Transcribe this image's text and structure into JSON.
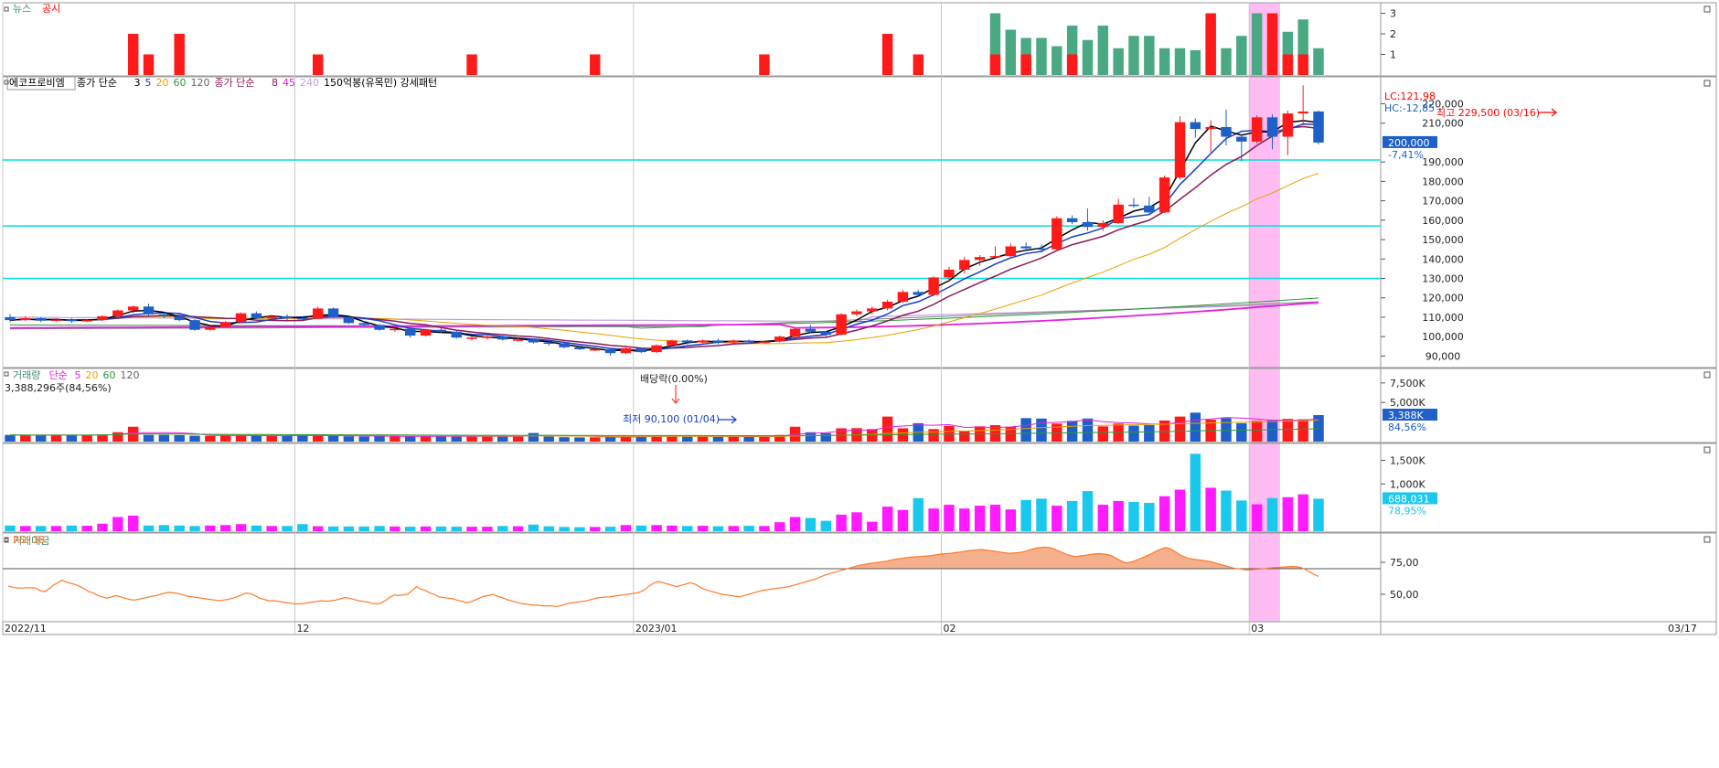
{
  "panels": {
    "news": {
      "labels": [
        "뉴스",
        "공시"
      ],
      "label_colors": [
        "#3a8f6a",
        "#ff0000"
      ],
      "ticks": [
        "3",
        "2",
        "1"
      ]
    },
    "price": {
      "legend": [
        {
          "text": "에코프로비엠",
          "color": "#000000"
        },
        {
          "text": "종가 단순",
          "color": "#000000"
        },
        {
          "text": "3",
          "color": "#000000"
        },
        {
          "text": "5",
          "color": "#1a3fc4"
        },
        {
          "text": "20",
          "color": "#e8a000"
        },
        {
          "text": "60",
          "color": "#2a9a3a"
        },
        {
          "text": "120",
          "color": "#666666"
        },
        {
          "text": "종가 단순",
          "color": "#8b1a5a"
        },
        {
          "text": "8",
          "color": "#8b1a5a"
        },
        {
          "text": "45",
          "color": "#e020e0"
        },
        {
          "text": "240",
          "color": "#c0a0e0"
        },
        {
          "text": "150억봉(유목민) 강세패턴",
          "color": "#000000"
        }
      ],
      "ticks": [
        "220,000",
        "210,000",
        "190,000",
        "180,000",
        "170,000",
        "160,000",
        "150,000",
        "140,000",
        "130,000",
        "120,000",
        "110,000",
        "100,000",
        "90,000"
      ],
      "lc": "LC:121,98",
      "hc": "HC:-12,85",
      "current": "200,000",
      "current_pct": "-7,41%",
      "annotations": {
        "high": "최고 229,500 (03/16)",
        "low": "최저 90,100 (01/04)",
        "dividend": "배당락(0.00%)"
      }
    },
    "volume": {
      "legend": [
        {
          "text": "거래량",
          "color": "#3a8f6a"
        },
        {
          "text": "단순",
          "color": "#e020e0"
        },
        {
          "text": "5",
          "color": "#e020e0"
        },
        {
          "text": "20",
          "color": "#e8a000"
        },
        {
          "text": "60",
          "color": "#2a9a3a"
        },
        {
          "text": "120",
          "color": "#666666"
        }
      ],
      "info": "3,388,296주(84,56%)",
      "ticks": [
        "7,500K",
        "5,000K"
      ],
      "current": "3,388K",
      "current_pct": "84,56%"
    },
    "amount": {
      "legend": "거래대금",
      "ticks": [
        "1,500K",
        "1,000K"
      ],
      "current": "688,031",
      "current_pct": "78,95%"
    },
    "rsi": {
      "legend": "RSI 18",
      "ticks": [
        "75,00",
        "50,00"
      ]
    }
  },
  "xaxis": {
    "labels": [
      "2022/11",
      "12",
      "2023/01",
      "02",
      "03"
    ],
    "right_label": "03/17"
  },
  "colors": {
    "up": "#ff1a1a",
    "down": "#1e5fc8",
    "news": "#4aa882",
    "amount_up": "#ff1aff",
    "amount_down": "#1ac8ee",
    "rsi": "#ff7a2a",
    "rsi_fill": "#f4a882",
    "highlight": "#ffb0f0",
    "hline": "#00e0e0"
  },
  "chart_data": {
    "type": "candlestick",
    "title": "에코프로비엠",
    "ylim": [
      85000,
      232000
    ],
    "hlines": [
      191000,
      157000,
      130000
    ],
    "candles": [
      [
        110000,
        111500,
        107500,
        108500
      ],
      [
        108500,
        110500,
        108000,
        109500
      ],
      [
        109500,
        110000,
        107500,
        108200
      ],
      [
        108200,
        109500,
        107800,
        108800
      ],
      [
        108800,
        109500,
        107000,
        108000
      ],
      [
        108000,
        109000,
        107500,
        108500
      ],
      [
        108500,
        111000,
        108000,
        110500
      ],
      [
        110500,
        114000,
        110000,
        113500
      ],
      [
        113500,
        116000,
        112000,
        115500
      ],
      [
        115500,
        117000,
        111000,
        111500
      ],
      [
        111500,
        112500,
        109500,
        110500
      ],
      [
        110500,
        111500,
        108000,
        108500
      ],
      [
        108500,
        109000,
        103000,
        103500
      ],
      [
        103500,
        105500,
        103000,
        105000
      ],
      [
        105000,
        108000,
        104500,
        107500
      ],
      [
        107500,
        112500,
        107000,
        112000
      ],
      [
        112000,
        113000,
        109000,
        109500
      ],
      [
        109500,
        111000,
        109000,
        110500
      ],
      [
        110500,
        111500,
        108500,
        109500
      ],
      [
        109500,
        110500,
        108500,
        109200
      ],
      [
        109200,
        115500,
        109000,
        114500
      ],
      [
        114500,
        115000,
        109500,
        110000
      ],
      [
        110000,
        111000,
        106500,
        107000
      ],
      [
        107000,
        108000,
        105500,
        106000
      ],
      [
        106000,
        106500,
        103000,
        103500
      ],
      [
        103500,
        104500,
        102500,
        104000
      ],
      [
        104000,
        104500,
        99500,
        100500
      ],
      [
        100500,
        104000,
        100000,
        103500
      ],
      [
        103500,
        104500,
        102000,
        102500
      ],
      [
        102500,
        103000,
        99000,
        99500
      ],
      [
        99500,
        100000,
        98000,
        99500
      ],
      [
        99500,
        100500,
        98500,
        100000
      ],
      [
        100000,
        100500,
        98000,
        98500
      ],
      [
        98500,
        99500,
        97500,
        98500
      ],
      [
        98500,
        99000,
        96500,
        97000
      ],
      [
        97000,
        98000,
        95500,
        96500
      ],
      [
        96500,
        97500,
        94000,
        94500
      ],
      [
        94500,
        95000,
        93000,
        93500
      ],
      [
        93500,
        94500,
        92500,
        93500
      ],
      [
        93500,
        94000,
        90100,
        91500
      ],
      [
        91500,
        94500,
        91000,
        94000
      ],
      [
        94000,
        94500,
        91500,
        92000
      ],
      [
        92000,
        96000,
        91500,
        95500
      ],
      [
        95500,
        98500,
        95000,
        98000
      ],
      [
        98000,
        98500,
        96000,
        97000
      ],
      [
        97000,
        98500,
        96500,
        98000
      ],
      [
        98000,
        99000,
        96000,
        97000
      ],
      [
        97000,
        98500,
        96500,
        98000
      ],
      [
        98000,
        98500,
        96500,
        97000
      ],
      [
        97000,
        98000,
        96500,
        97500
      ],
      [
        97500,
        100500,
        97000,
        100000
      ],
      [
        100000,
        104500,
        99500,
        104000
      ],
      [
        104000,
        106000,
        102000,
        102500
      ],
      [
        102500,
        103000,
        100000,
        101000
      ],
      [
        101000,
        112000,
        100500,
        111500
      ],
      [
        111500,
        114000,
        110500,
        113000
      ],
      [
        113000,
        115500,
        111500,
        114500
      ],
      [
        114500,
        119000,
        113500,
        118000
      ],
      [
        118000,
        124000,
        117500,
        123000
      ],
      [
        123000,
        124000,
        120500,
        121500
      ],
      [
        121500,
        131000,
        121000,
        130500
      ],
      [
        130500,
        136000,
        128500,
        134500
      ],
      [
        134500,
        141000,
        132500,
        139500
      ],
      [
        139500,
        142000,
        136500,
        141000
      ],
      [
        141000,
        146500,
        140500,
        141500
      ],
      [
        141500,
        148000,
        140500,
        146500
      ],
      [
        146500,
        148500,
        144000,
        145500
      ],
      [
        145500,
        147500,
        144000,
        145000
      ],
      [
        145000,
        162000,
        144500,
        161000
      ],
      [
        161000,
        162500,
        158000,
        159000
      ],
      [
        159000,
        166000,
        154500,
        156500
      ],
      [
        156500,
        160000,
        154500,
        158500
      ],
      [
        158500,
        171000,
        158000,
        168000
      ],
      [
        168000,
        171500,
        166500,
        167500
      ],
      [
        167500,
        172000,
        163000,
        164000
      ],
      [
        164000,
        183000,
        163500,
        182000
      ],
      [
        182000,
        213500,
        181000,
        210500
      ],
      [
        210500,
        212500,
        202500,
        207000
      ],
      [
        207000,
        211500,
        195000,
        208000
      ],
      [
        208000,
        217000,
        198500,
        203000
      ],
      [
        203000,
        204500,
        190500,
        200500
      ],
      [
        200500,
        214000,
        199500,
        213000
      ],
      [
        213000,
        214500,
        196500,
        203000
      ],
      [
        203000,
        216500,
        193500,
        215000
      ],
      [
        215000,
        229500,
        209000,
        216000
      ],
      [
        216000,
        216500,
        199000,
        200000
      ]
    ],
    "volume_k": [
      850,
      820,
      820,
      820,
      830,
      830,
      900,
      1200,
      1900,
      850,
      850,
      820,
      750,
      720,
      750,
      820,
      750,
      720,
      720,
      900,
      720,
      720,
      680,
      650,
      720,
      680,
      650,
      700,
      680,
      650,
      650,
      680,
      700,
      640,
      1100,
      640,
      560,
      540,
      550,
      560,
      720,
      700,
      720,
      720,
      620,
      650,
      610,
      640,
      660,
      650,
      850,
      1900,
      1200,
      1080,
      1700,
      1720,
      1600,
      3200,
      1700,
      2350,
      1600,
      2000,
      1400,
      1950,
      2100,
      1900,
      3000,
      2950,
      2300,
      2650,
      2950,
      1950,
      2300,
      2050,
      2100,
      2700,
      3200,
      3700,
      2800,
      3000,
      2350,
      2650,
      2800,
      2900,
      2850,
      3388
    ],
    "amount_k": [
      120,
      110,
      110,
      110,
      120,
      115,
      160,
      300,
      330,
      120,
      130,
      120,
      110,
      120,
      130,
      150,
      120,
      110,
      110,
      150,
      105,
      100,
      100,
      100,
      110,
      100,
      95,
      100,
      100,
      95,
      95,
      95,
      110,
      105,
      140,
      105,
      90,
      85,
      90,
      95,
      130,
      120,
      130,
      120,
      110,
      115,
      105,
      110,
      115,
      110,
      190,
      300,
      280,
      220,
      350,
      400,
      200,
      520,
      450,
      700,
      480,
      560,
      480,
      540,
      560,
      460,
      660,
      690,
      540,
      640,
      850,
      560,
      640,
      620,
      600,
      740,
      880,
      1640,
      920,
      860,
      650,
      570,
      700,
      720,
      780,
      688
    ],
    "rsi": [
      56.5,
      55.5,
      55,
      54.8,
      55.2,
      55,
      55,
      53,
      52,
      54,
      57,
      59,
      61,
      59.5,
      58.5,
      57.5,
      56,
      54,
      52,
      51,
      49,
      48,
      47,
      48,
      49,
      48,
      47,
      46,
      45.5,
      46,
      47,
      47.5,
      48.5,
      49,
      50,
      51,
      51.5,
      51,
      50.5,
      49.5,
      48.5,
      48,
      47.5,
      47,
      46.5,
      46,
      45.5,
      45,
      45.5,
      46,
      47,
      48,
      49.5,
      51,
      50.5,
      49,
      47,
      46,
      45,
      45,
      44.5,
      44,
      43.5,
      43,
      42.5,
      42.5,
      42.8,
      43.5,
      44,
      44.5,
      45,
      44.5,
      45,
      45.5,
      46.5,
      47.5,
      47,
      46,
      45,
      44.5,
      44,
      43,
      42.5,
      43,
      45,
      47.5,
      49.5,
      49,
      49.5,
      50,
      53,
      56,
      54,
      53,
      51,
      50,
      48,
      47.5,
      47,
      46.5,
      45.5,
      44.5,
      43.5,
      44,
      45.5,
      47,
      48.5,
      49,
      50,
      48.5,
      47.5,
      46,
      45,
      44,
      43,
      42.5,
      42,
      41.5,
      41.5,
      41,
      41,
      41,
      40.5,
      41,
      42,
      43,
      43.5,
      44,
      44.5,
      45,
      46,
      47,
      47.5,
      47.8,
      48,
      48.5,
      49,
      49.5,
      50,
      50.5,
      51,
      52,
      54,
      57,
      59,
      60,
      59,
      58,
      57,
      56,
      57,
      58,
      59,
      58,
      56,
      54,
      53,
      52,
      51,
      50,
      49.5,
      49,
      48.5,
      48,
      49,
      50,
      51,
      52,
      53,
      53.5,
      54,
      54.5,
      55,
      55.5,
      56,
      57,
      58,
      59,
      60,
      61,
      62,
      63.5,
      65,
      66,
      67,
      68,
      69,
      70,
      71,
      72,
      73,
      73.5,
      74,
      74.5,
      75,
      75.5,
      76,
      77,
      77.5,
      78,
      78.5,
      79,
      79.2,
      79.5,
      79.8,
      80,
      80.5,
      81,
      81.5,
      81.8,
      82,
      82.5,
      83,
      83.5,
      84,
      84.5,
      84.8,
      85,
      84.5,
      84,
      83.5,
      83,
      82.5,
      82,
      82.2,
      82.5,
      83,
      84,
      85,
      86,
      86.5,
      86.8,
      86.5,
      85.5,
      84,
      82.5,
      81,
      80,
      79.5,
      80,
      80.5,
      81,
      81.5,
      81.8,
      81.5,
      81,
      80,
      78,
      76,
      74.5,
      75,
      76,
      77.5,
      79,
      80.5,
      82,
      84,
      85.5,
      86.5,
      85.5,
      83.5,
      81,
      79.5,
      78,
      77.5,
      77,
      76.5,
      76,
      75.5,
      74.5,
      73.5,
      72.5,
      71.5,
      70.5,
      70,
      69.5,
      69,
      69.2,
      69.5,
      69.8,
      70,
      70.5,
      70.8,
      71,
      71.2,
      71.5,
      71.8,
      71.5,
      71,
      69.5,
      67.5,
      65.5,
      64
    ]
  }
}
